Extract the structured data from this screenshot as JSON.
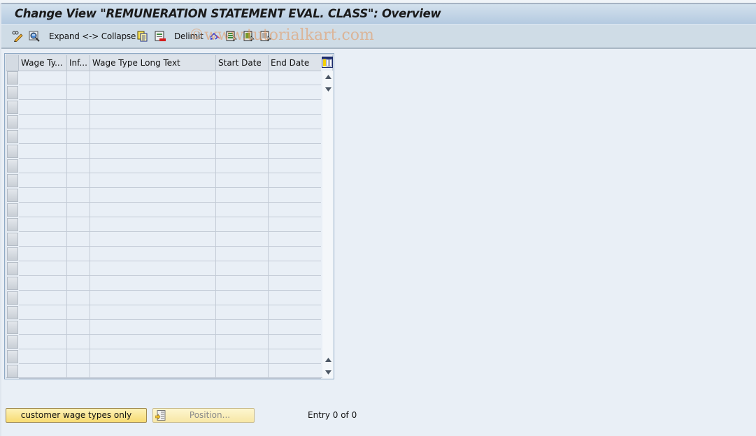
{
  "window": {
    "title": "Change View \"REMUNERATION STATEMENT EVAL. CLASS\": Overview"
  },
  "toolbar": {
    "items": [
      {
        "icon": "pencil-glasses-icon",
        "label": ""
      },
      {
        "icon": "display-magnifier-icon",
        "label": ""
      },
      {
        "icon": "",
        "label": "Expand <-> Collapse"
      },
      {
        "icon": "copy-icon",
        "label": ""
      },
      {
        "icon": "delete-icon",
        "label": ""
      },
      {
        "icon": "",
        "label": "Delimit"
      },
      {
        "icon": "undo-icon",
        "label": ""
      },
      {
        "icon": "select-all-icon",
        "label": ""
      },
      {
        "icon": "select-block-icon",
        "label": ""
      },
      {
        "icon": "deselect-all-icon",
        "label": ""
      }
    ],
    "watermark": "©www.tutorialkart.com"
  },
  "table": {
    "columns": [
      {
        "label": "Wage Ty..."
      },
      {
        "label": "Inf..."
      },
      {
        "label": "Wage Type Long Text"
      },
      {
        "label": "Start Date"
      },
      {
        "label": "End Date"
      }
    ],
    "rows": [
      [
        "",
        "",
        "",
        "",
        ""
      ],
      [
        "",
        "",
        "",
        "",
        ""
      ],
      [
        "",
        "",
        "",
        "",
        ""
      ],
      [
        "",
        "",
        "",
        "",
        ""
      ],
      [
        "",
        "",
        "",
        "",
        ""
      ],
      [
        "",
        "",
        "",
        "",
        ""
      ],
      [
        "",
        "",
        "",
        "",
        ""
      ],
      [
        "",
        "",
        "",
        "",
        ""
      ],
      [
        "",
        "",
        "",
        "",
        ""
      ],
      [
        "",
        "",
        "",
        "",
        ""
      ],
      [
        "",
        "",
        "",
        "",
        ""
      ],
      [
        "",
        "",
        "",
        "",
        ""
      ],
      [
        "",
        "",
        "",
        "",
        ""
      ],
      [
        "",
        "",
        "",
        "",
        ""
      ],
      [
        "",
        "",
        "",
        "",
        ""
      ],
      [
        "",
        "",
        "",
        "",
        ""
      ],
      [
        "",
        "",
        "",
        "",
        ""
      ],
      [
        "",
        "",
        "",
        "",
        ""
      ],
      [
        "",
        "",
        "",
        "",
        ""
      ],
      [
        "",
        "",
        "",
        "",
        ""
      ],
      [
        "",
        "",
        "",
        "",
        ""
      ]
    ],
    "column_settings_icon": "table-settings-icon"
  },
  "footer": {
    "customer_button_label": "customer wage types only",
    "position_button_label": "Position...",
    "entry_text": "Entry 0 of 0"
  }
}
